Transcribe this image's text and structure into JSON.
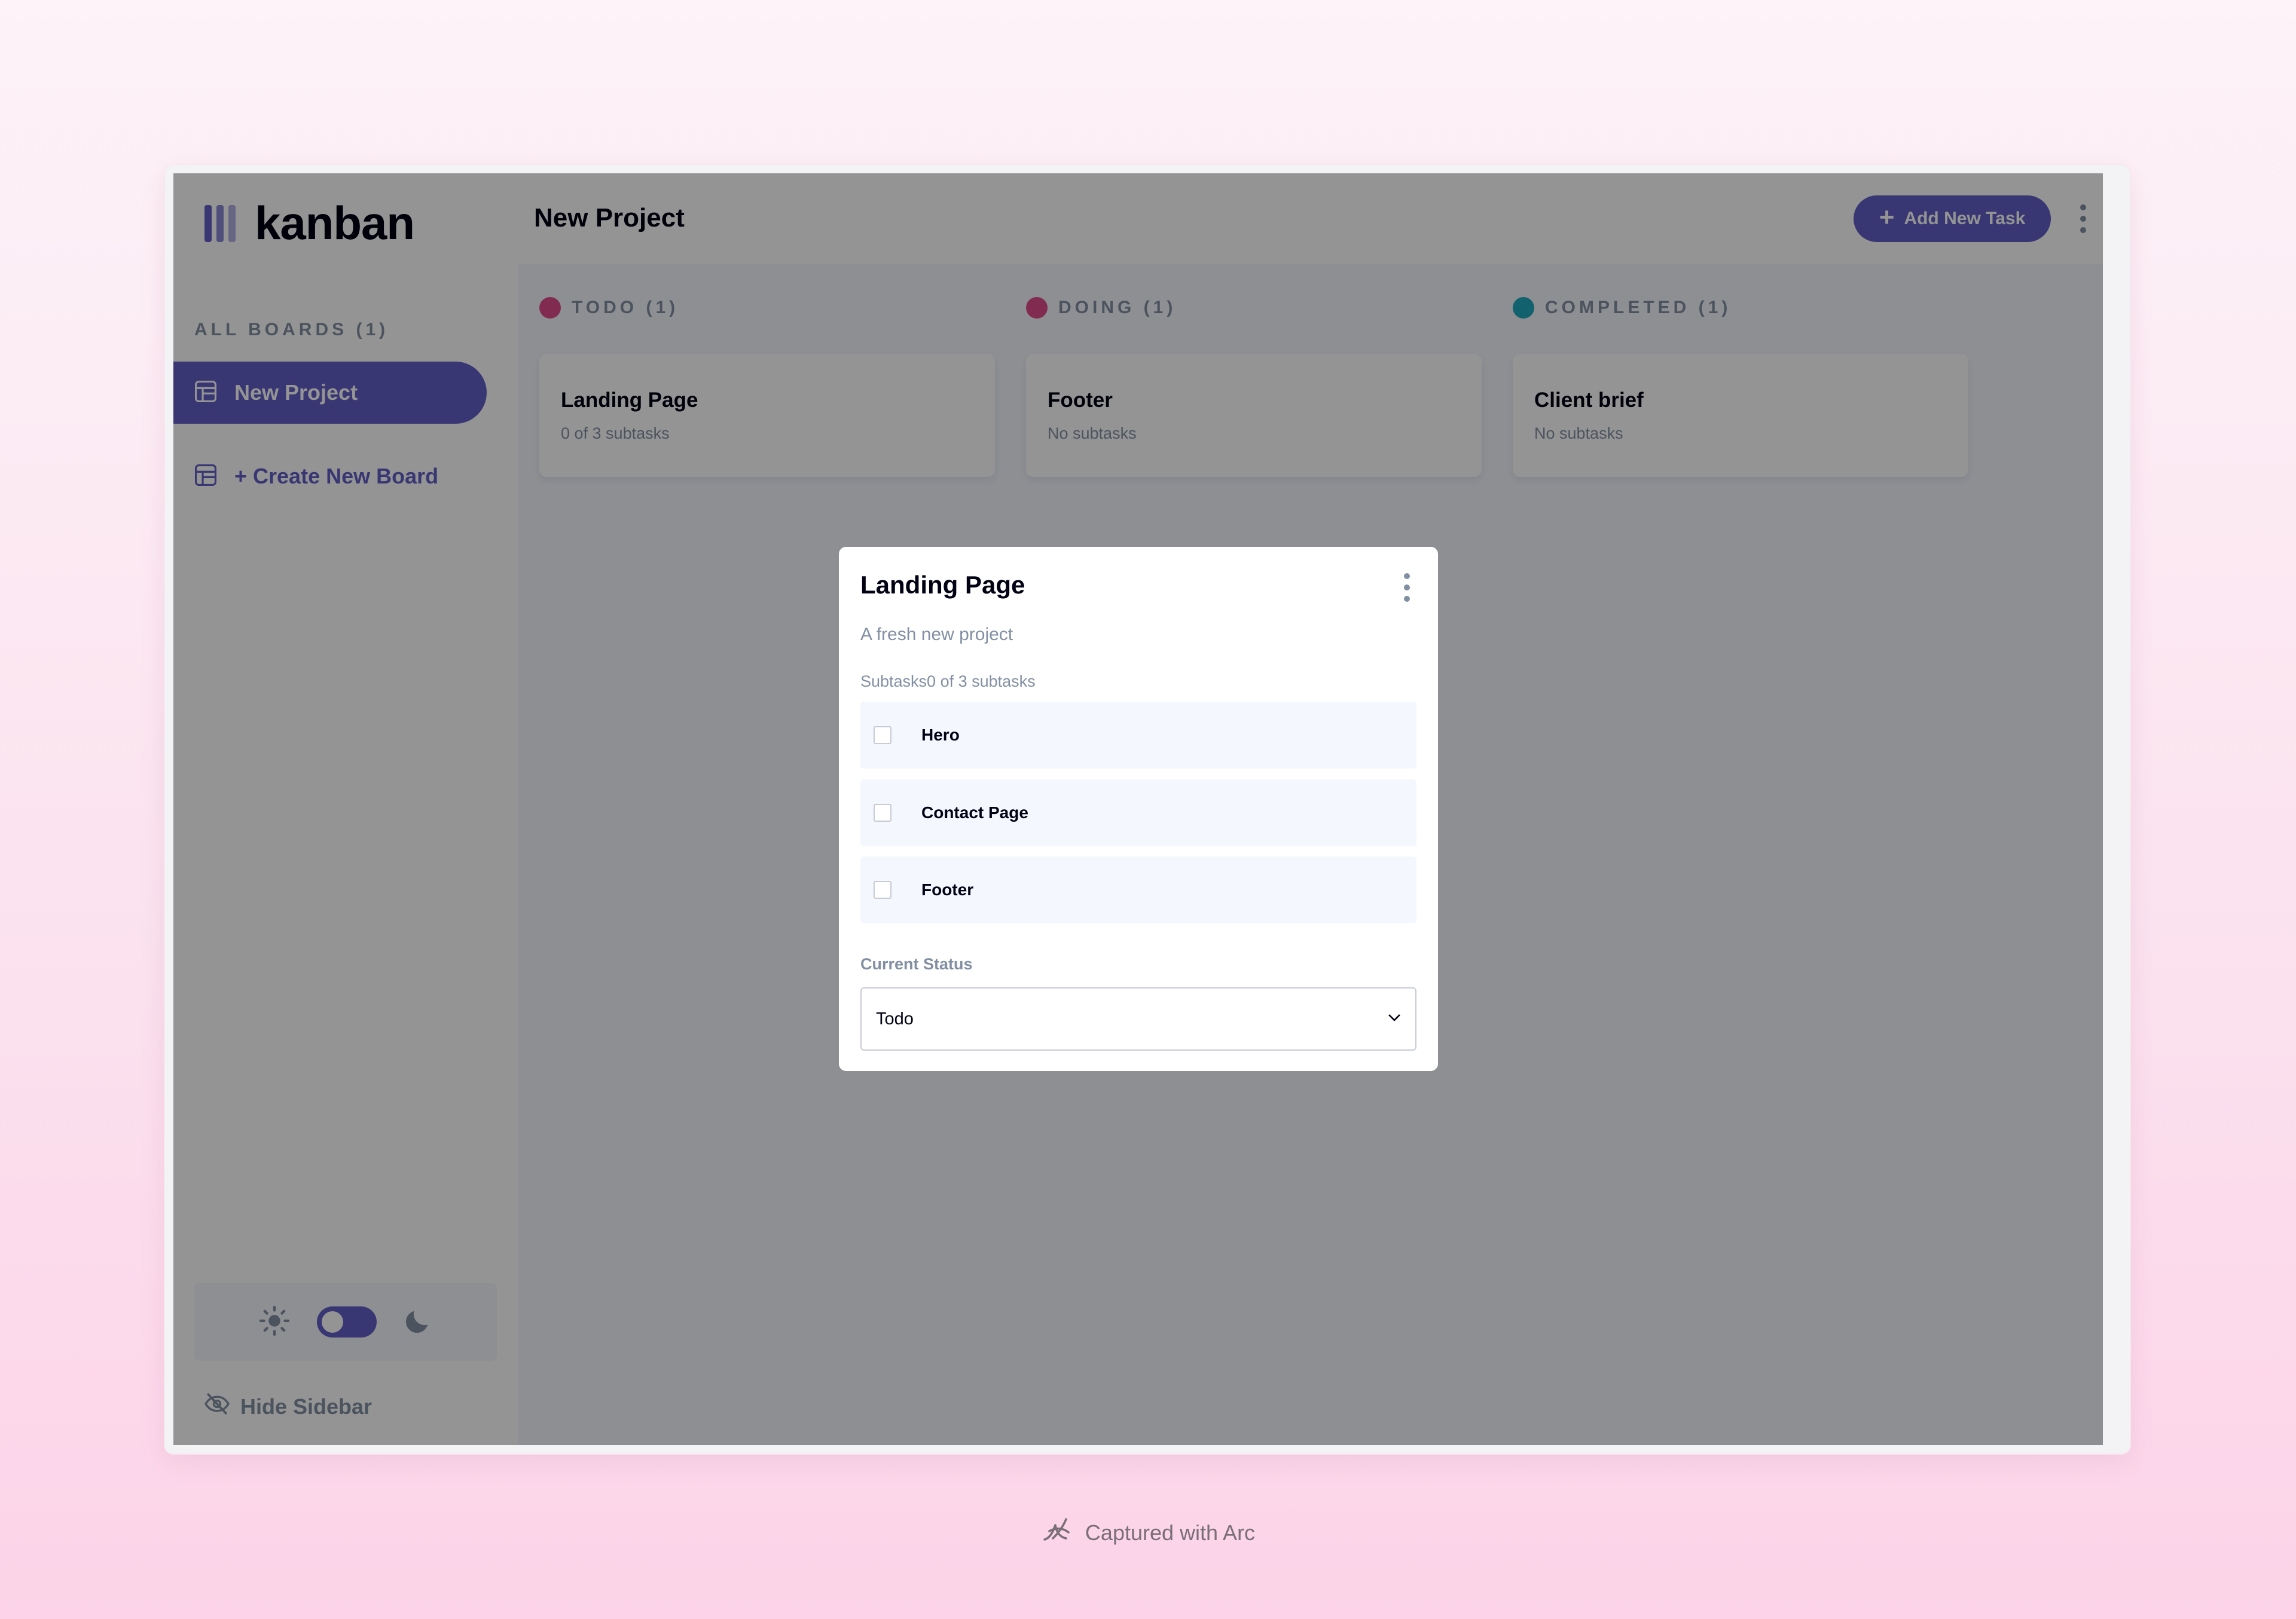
{
  "app": {
    "logo_text": "kanban"
  },
  "sidebar": {
    "heading": "ALL BOARDS (1)",
    "boards": [
      {
        "label": "New Project"
      }
    ],
    "create_label": "+ Create New Board",
    "hide_label": "Hide Sidebar",
    "theme": {
      "light_icon": "sun-icon",
      "dark_icon": "moon-icon",
      "mode": "light"
    }
  },
  "header": {
    "board_title": "New Project",
    "add_task_label": "Add New Task",
    "menu_icon": "vertical-dots-icon"
  },
  "columns": [
    {
      "title": "TODO (1)",
      "color": "#e14b8a",
      "cards": [
        {
          "title": "Landing Page",
          "subtitle": "0 of 3 subtasks"
        }
      ]
    },
    {
      "title": "DOING (1)",
      "color": "#e14b8a",
      "cards": [
        {
          "title": "Footer",
          "subtitle": "No subtasks"
        }
      ]
    },
    {
      "title": "COMPLETED (1)",
      "color": "#1fa7bd",
      "cards": [
        {
          "title": "Client brief",
          "subtitle": "No subtasks"
        }
      ]
    }
  ],
  "modal": {
    "title": "Landing Page",
    "description": "A fresh new project",
    "subtasks_heading": "Subtasks0 of 3 subtasks",
    "subtasks": [
      {
        "label": "Hero",
        "done": false
      },
      {
        "label": "Contact Page",
        "done": false
      },
      {
        "label": "Footer",
        "done": false
      }
    ],
    "status_label": "Current Status",
    "status_value": "Todo"
  },
  "footer": {
    "caption": "Captured with Arc"
  },
  "colors": {
    "accent": "#635fc7",
    "muted": "#828fa3",
    "board_bg": "#f4f7fd"
  }
}
